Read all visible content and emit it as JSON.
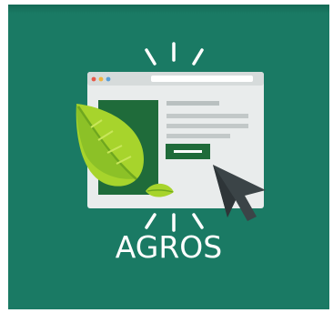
{
  "app": {
    "name": "AGROS"
  },
  "colors": {
    "tile": "#1a7a64",
    "browser_frame": "#e9ecec",
    "browser_bar": "#d6dbdb",
    "panel_green": "#1f6b3a",
    "leaf_light": "#a7d42c",
    "leaf_dark": "#6fa71f",
    "cursor": "#3b4447",
    "text_lines": "#c2c8c8",
    "cta_button": "#1f6b3a",
    "dot_red": "#e85a4a",
    "dot_yellow": "#f2b33c",
    "dot_blue": "#5a9fd6"
  },
  "icons": {
    "illustration": "browser-window-with-leaf-and-cursor"
  }
}
